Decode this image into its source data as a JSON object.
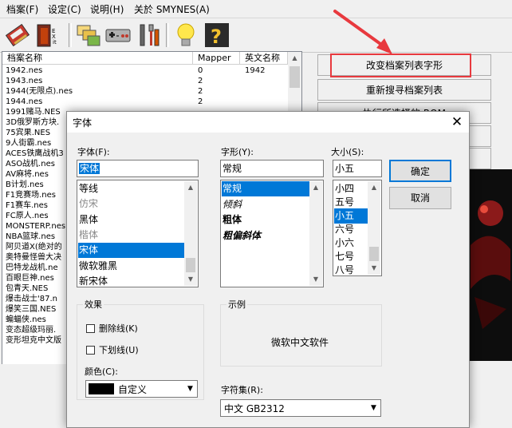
{
  "menubar": {
    "items": [
      "档案(F)",
      "设定(C)",
      "说明(H)",
      "关於 SMYNES(A)"
    ]
  },
  "toolbar": {
    "icons": [
      "rom-icon",
      "exit-icon",
      "windows-icon",
      "gamepad-icon",
      "tools-icon",
      "lightbulb-icon",
      "help-icon"
    ]
  },
  "filelist": {
    "columns": [
      "档案名称",
      "Mapper",
      "英文名称"
    ],
    "rows": [
      {
        "name": "1942.nes",
        "mapper": "0",
        "english": "1942"
      },
      {
        "name": "1943.nes",
        "mapper": "2",
        "english": ""
      },
      {
        "name": "1944(无限点).nes",
        "mapper": "2",
        "english": ""
      },
      {
        "name": "1944.nes",
        "mapper": "2",
        "english": ""
      },
      {
        "name": "1991赌马.NES",
        "mapper": "",
        "english": ""
      },
      {
        "name": "3D俄罗斯方块.",
        "mapper": "",
        "english": ""
      },
      {
        "name": "75宾果.NES",
        "mapper": "",
        "english": ""
      },
      {
        "name": "9人街霸.nes",
        "mapper": "",
        "english": ""
      },
      {
        "name": "ACES铁鹰战机3",
        "mapper": "",
        "english": ""
      },
      {
        "name": "ASO战机.nes",
        "mapper": "",
        "english": ""
      },
      {
        "name": "AV麻将.nes",
        "mapper": "",
        "english": ""
      },
      {
        "name": "B计划.nes",
        "mapper": "",
        "english": ""
      },
      {
        "name": "F1竞赛场.nes",
        "mapper": "",
        "english": ""
      },
      {
        "name": "F1赛车.nes",
        "mapper": "",
        "english": ""
      },
      {
        "name": "FC原人.nes",
        "mapper": "",
        "english": ""
      },
      {
        "name": "MONSTERP.nes",
        "mapper": "",
        "english": ""
      },
      {
        "name": "NBA篮球.nes",
        "mapper": "",
        "english": ""
      },
      {
        "name": "阿贝道X(绝对的",
        "mapper": "",
        "english": ""
      },
      {
        "name": "奥特曼怪兽大决",
        "mapper": "",
        "english": ""
      },
      {
        "name": "巴特龙战机.ne",
        "mapper": "",
        "english": ""
      },
      {
        "name": "百眼巨神.nes",
        "mapper": "",
        "english": ""
      },
      {
        "name": "包青天.NES",
        "mapper": "",
        "english": ""
      },
      {
        "name": "爆击战士'87.n",
        "mapper": "",
        "english": ""
      },
      {
        "name": "爆笑三国.NES",
        "mapper": "",
        "english": ""
      },
      {
        "name": "蝙蝠侠.nes",
        "mapper": "",
        "english": ""
      },
      {
        "name": "变态超级玛丽.",
        "mapper": "",
        "english": ""
      },
      {
        "name": "变形坦克中文版",
        "mapper": "",
        "english": ""
      }
    ]
  },
  "right_buttons": {
    "change_font": "改变档案列表字形",
    "research_list": "重新搜寻档案列表",
    "run_selected": "执行所选择的 ROM"
  },
  "dialog": {
    "title": "字体",
    "font_label": "字体(F):",
    "font_value": "宋体",
    "font_list": [
      "等线",
      "仿宋",
      "黑体",
      "楷体",
      "宋体",
      "微软雅黑",
      "新宋体"
    ],
    "font_selected": "宋体",
    "style_label": "字形(Y):",
    "style_value": "常规",
    "style_list": [
      "常规",
      "倾斜",
      "粗体",
      "粗偏斜体"
    ],
    "style_selected": "常规",
    "size_label": "大小(S):",
    "size_value": "小五",
    "size_list": [
      "小四",
      "五号",
      "小五",
      "六号",
      "小六",
      "七号",
      "八号"
    ],
    "size_selected": "小五",
    "ok_button": "确定",
    "cancel_button": "取消",
    "effects_label": "效果",
    "strikeout_label": "删除线(K)",
    "underline_label": "下划线(U)",
    "color_label": "颜色(C):",
    "color_value": "自定义",
    "color_swatch": "#000000",
    "sample_label": "示例",
    "sample_text": "微软中文软件",
    "charset_label": "字符集(R):",
    "charset_value": "中文 GB2312"
  },
  "colors": {
    "selection": "#0078d7",
    "annotation_red": "#e8393e"
  }
}
